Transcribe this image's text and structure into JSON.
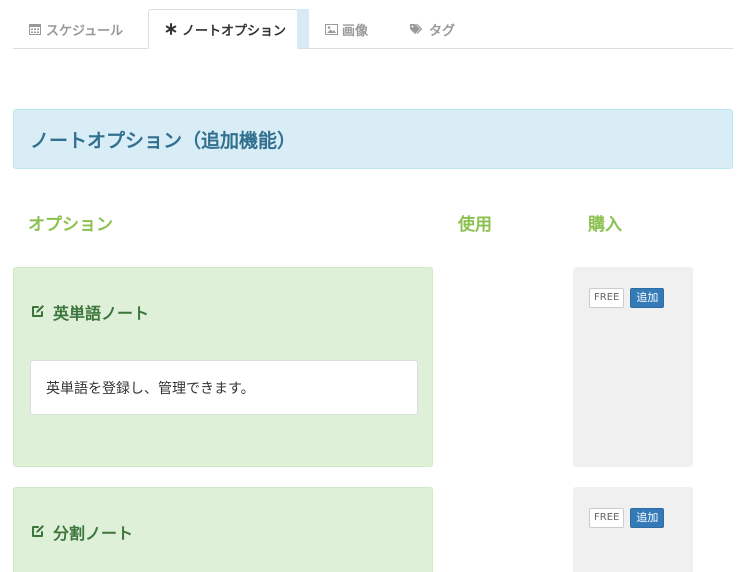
{
  "tabs": {
    "schedule": "スケジュール",
    "note_options": "ノートオプション",
    "image": "画像",
    "tag": "タグ"
  },
  "heading": "ノートオプション（追加機能）",
  "columns": {
    "option": "オプション",
    "use": "使用",
    "buy": "購入"
  },
  "options": [
    {
      "title": "英単語ノート",
      "description": "英単語を登録し、管理できます。",
      "price_badge": "FREE",
      "add_label": "追加"
    },
    {
      "title": "分割ノート",
      "price_badge": "FREE",
      "add_label": "追加"
    }
  ],
  "colors": {
    "accent_green": "#8cc152",
    "info_bg": "#d9edf7",
    "info_text": "#31708f",
    "success_bg": "#dff0d8",
    "success_text": "#3c763d",
    "primary": "#337ab7"
  },
  "icons": {
    "schedule": "calendar-icon",
    "note_options": "asterisk-icon",
    "image": "picture-icon",
    "tag": "tags-icon",
    "option": "edit-icon"
  }
}
